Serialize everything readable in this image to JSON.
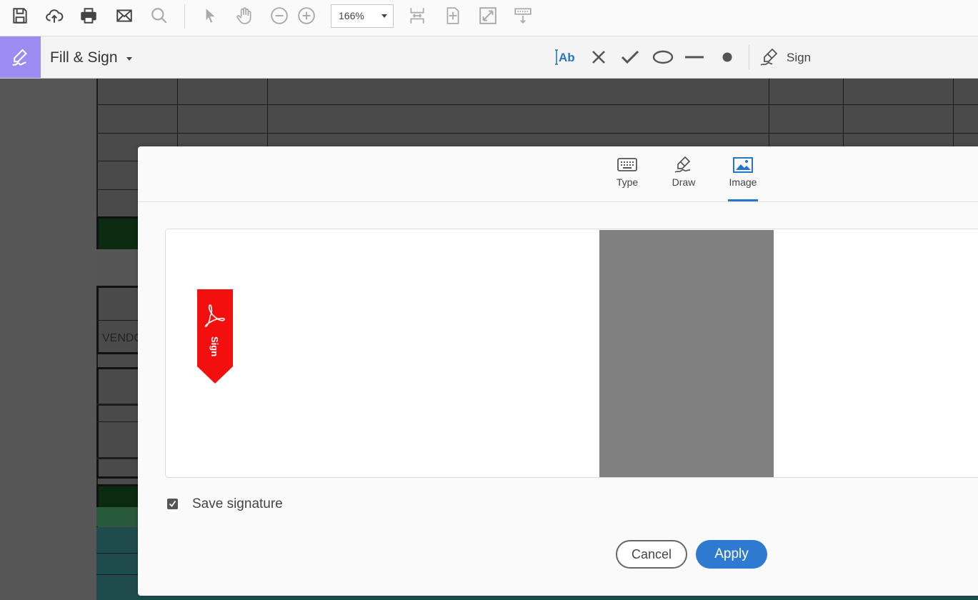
{
  "toolbar": {
    "icons": [
      "save-icon",
      "cloud-upload-icon",
      "print-icon",
      "email-icon",
      "search-icon",
      "select-arrow-icon",
      "hand-icon",
      "zoom-out-icon",
      "zoom-in-icon",
      "scroll-mode-icon",
      "fit-page-icon",
      "full-screen-icon",
      "read-mode-icon"
    ],
    "zoom_value": "166%"
  },
  "fill_sign": {
    "title": "Fill & Sign",
    "tools": [
      "add-text-icon",
      "cross-mark-icon",
      "check-mark-icon",
      "ellipse-icon",
      "line-icon",
      "dot-icon"
    ],
    "sign_label": "Sign",
    "accent": "#9c8cf2"
  },
  "document": {
    "partial_text": "VENDO"
  },
  "dialog": {
    "tabs": [
      {
        "label": "Type",
        "icon": "keyboard-icon"
      },
      {
        "label": "Draw",
        "icon": "pen-icon"
      },
      {
        "label": "Image",
        "icon": "image-icon"
      }
    ],
    "active_tab": "Image",
    "sign_flag_text": "Sign",
    "save_signature_label": "Save signature",
    "save_signature_checked": true,
    "cancel_label": "Cancel",
    "apply_label": "Apply",
    "accent": "#2d7ad0"
  }
}
